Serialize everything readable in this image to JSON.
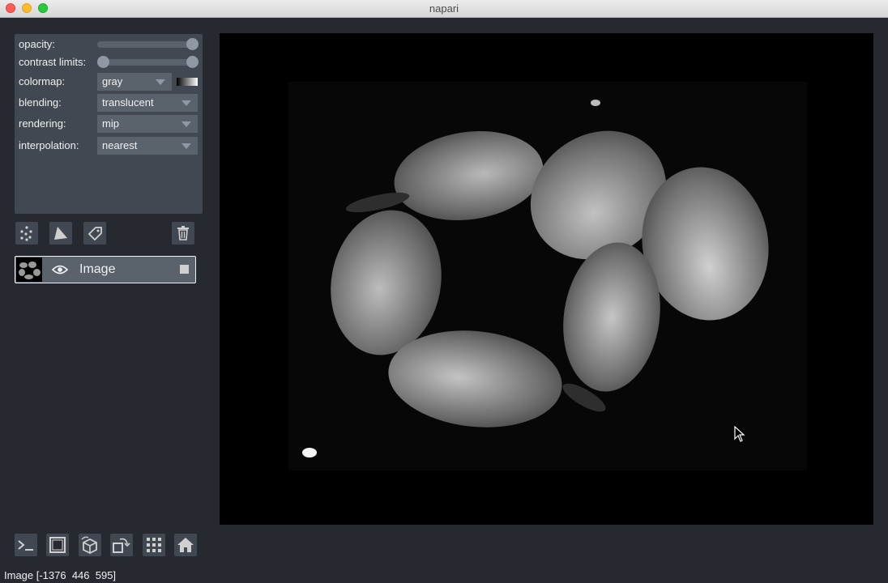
{
  "window": {
    "title": "napari"
  },
  "controls": {
    "opacity_label": "opacity:",
    "contrast_label": "contrast limits:",
    "colormap_label": "colormap:",
    "colormap_value": "gray",
    "blending_label": "blending:",
    "blending_value": "translucent",
    "rendering_label": "rendering:",
    "rendering_value": "mip",
    "interpolation_label": "interpolation:",
    "interpolation_value": "nearest",
    "opacity_value": 1.0,
    "contrast_limits": [
      0.0,
      1.0
    ]
  },
  "layer_buttons": [
    "new-points-icon",
    "new-shapes-icon",
    "new-labels-icon",
    "delete-icon"
  ],
  "layers": [
    {
      "name": "Image",
      "visible": true
    }
  ],
  "bottom_buttons": [
    "console-icon",
    "ndisplay-icon",
    "roll-icon",
    "transpose-icon",
    "grid-icon",
    "home-icon"
  ],
  "status": {
    "text": "Image [-1376  446  595]"
  },
  "colors": {
    "background": "#262930",
    "panel": "#414851",
    "control": "#5a626c",
    "text": "#f0f1f2"
  }
}
